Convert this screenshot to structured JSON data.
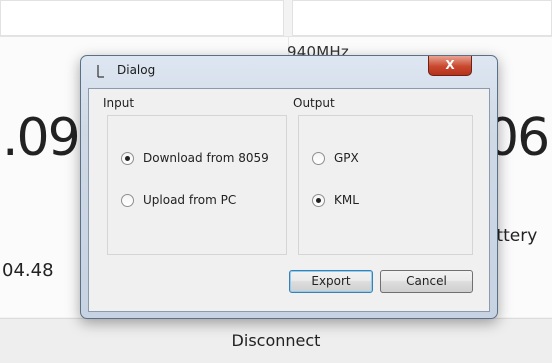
{
  "background": {
    "frequency": "940MHz",
    "big_value_left": ".09",
    "big_value_right": "06",
    "battery_label": "attery",
    "small_value_left": "04.48",
    "disconnect_label": "Disconnect"
  },
  "dialog": {
    "title": "Dialog",
    "close_glyph": "X",
    "input": {
      "label": "Input",
      "options": [
        {
          "label": "Download from 8059",
          "checked": true
        },
        {
          "label": "Upload from PC",
          "checked": false
        }
      ]
    },
    "output": {
      "label": "Output",
      "options": [
        {
          "label": "GPX",
          "checked": false
        },
        {
          "label": "KML",
          "checked": true
        }
      ]
    },
    "export_label": "Export",
    "cancel_label": "Cancel"
  }
}
